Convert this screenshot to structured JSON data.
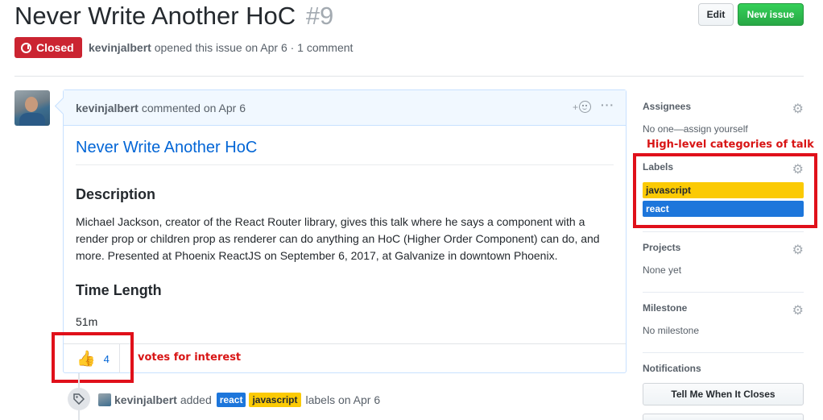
{
  "issue": {
    "title": "Never Write Another HoC",
    "number": "#9",
    "state": "Closed",
    "author": "kevinjalbert",
    "opened_text": "opened this issue on Apr 6 · 1 comment"
  },
  "header_buttons": {
    "edit": "Edit",
    "new_issue": "New issue"
  },
  "comment": {
    "author": "kevinjalbert",
    "meta": "commented on Apr 6",
    "add_reaction": "+",
    "more": "···",
    "heading": "Never Write Another HoC",
    "sections": [
      {
        "title": "Description",
        "text": "Michael Jackson, creator of the React Router library, gives this talk where he says a component with a render prop or children prop as renderer can do anything an HoC (Higher Order Component) can do, and more. Presented at Phoenix ReactJS on September 6, 2017, at Galvanize in downtown Phoenix."
      },
      {
        "title": "Time Length",
        "text": "51m"
      }
    ],
    "reaction": {
      "emoji": "👍",
      "count": "4"
    }
  },
  "annotations": {
    "votes": "votes for interest",
    "labels": "High-level categories of talk",
    "color": "#e0101a"
  },
  "event": {
    "actor": "kevinjalbert",
    "verb": "added",
    "labels": [
      {
        "name": "react",
        "color": "#1d76db",
        "text_color": "#ffffff"
      },
      {
        "name": "javascript",
        "color": "#fbca04",
        "text_color": "#24292e"
      }
    ],
    "suffix": "labels on Apr 6"
  },
  "sidebar": {
    "assignees": {
      "title": "Assignees",
      "value": "No one—assign yourself"
    },
    "labels": {
      "title": "Labels",
      "items": [
        {
          "name": "javascript",
          "color": "#fbca04",
          "text_color": "#24292e"
        },
        {
          "name": "react",
          "color": "#1d76db",
          "text_color": "#ffffff"
        }
      ]
    },
    "projects": {
      "title": "Projects",
      "value": "None yet"
    },
    "milestone": {
      "title": "Milestone",
      "value": "No milestone"
    },
    "notifications": {
      "title": "Notifications",
      "button": "Tell Me When It Closes"
    }
  },
  "colors": {
    "closed": "#cb2431",
    "link": "#0366d6",
    "new_issue": "#28a745"
  },
  "icons": [
    "closed-issue-icon",
    "smiley-icon",
    "kebab-icon",
    "tag-icon",
    "gear-icon"
  ]
}
